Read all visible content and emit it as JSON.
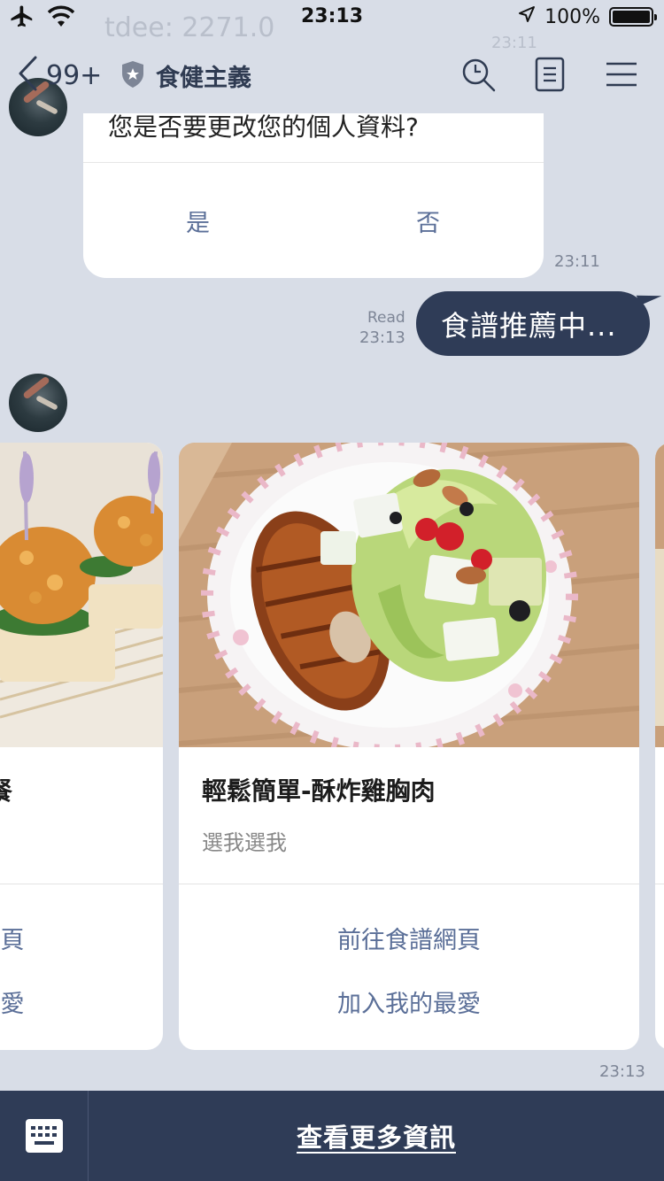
{
  "status_bar": {
    "time": "23:13",
    "battery": "100%",
    "battery_level": 1.0
  },
  "background_text": {
    "scrolled_line": "tdee: 2271.0",
    "scrolled_time": "23:11"
  },
  "header": {
    "back_count": "99+",
    "title": "食健主義"
  },
  "confirm_card": {
    "question": "您是否要更改您的個人資料?",
    "yes_label": "是",
    "no_label": "否",
    "time": "23:11"
  },
  "outgoing_message": {
    "text": "食譜推薦中...",
    "read_label": "Read",
    "time": "23:13"
  },
  "carousel": {
    "left_card": {
      "title_fragment": "餐",
      "action1_fragment": "頁",
      "action2_fragment": "愛"
    },
    "main_card": {
      "title": "輕鬆簡單-酥炸雞胸肉",
      "subtitle": "選我選我",
      "action1": "前往食譜網頁",
      "action2": "加入我的最愛"
    },
    "time": "23:13"
  },
  "footer": {
    "more_info_label": "查看更多資訊"
  },
  "colors": {
    "background": "#d8dde7",
    "navy": "#2f3c57",
    "link_blue": "#5b6f98"
  }
}
